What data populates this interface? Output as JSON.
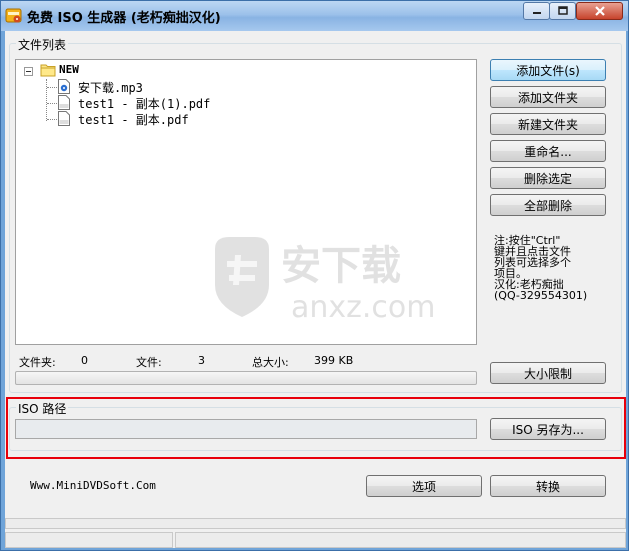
{
  "window": {
    "title": "免费 ISO 生成器 (老朽痴拙汉化)"
  },
  "file_list": {
    "legend": "文件列表",
    "tree": {
      "root": "NEW",
      "children": [
        "安下载.mp3",
        "test1 - 副本(1).pdf",
        "test1 - 副本.pdf"
      ]
    }
  },
  "buttons": {
    "add_files": "添加文件(s)",
    "add_folder": "添加文件夹",
    "new_folder": "新建文件夹",
    "rename": "重命名...",
    "delete_selected": "删除选定",
    "delete_all": "全部删除",
    "size_limit": "大小限制",
    "iso_save_as": "ISO 另存为...",
    "options": "选项",
    "convert": "转换"
  },
  "note": {
    "lines": [
      "注:按住\"Ctrl\"",
      "键并且点击文件",
      "列表可选择多个",
      "项目。",
      "汉化:老朽痴拙",
      "(QQ-329554301)"
    ]
  },
  "stats": {
    "folders_label": "文件夹:",
    "folders_value": "0",
    "files_label": "文件:",
    "files_value": "3",
    "total_label": "总大小:",
    "total_value": "399 KB"
  },
  "iso": {
    "legend": "ISO 路径",
    "path": ""
  },
  "footer": {
    "website": "Www.MiniDVDSoft.Com"
  },
  "watermark": {
    "brand": "安下载",
    "domain": "anxz.com"
  },
  "colors": {
    "highlight_border": "#e8000b",
    "title_gradient_top": "#bcd7f3",
    "close_button": "#c7432c"
  }
}
